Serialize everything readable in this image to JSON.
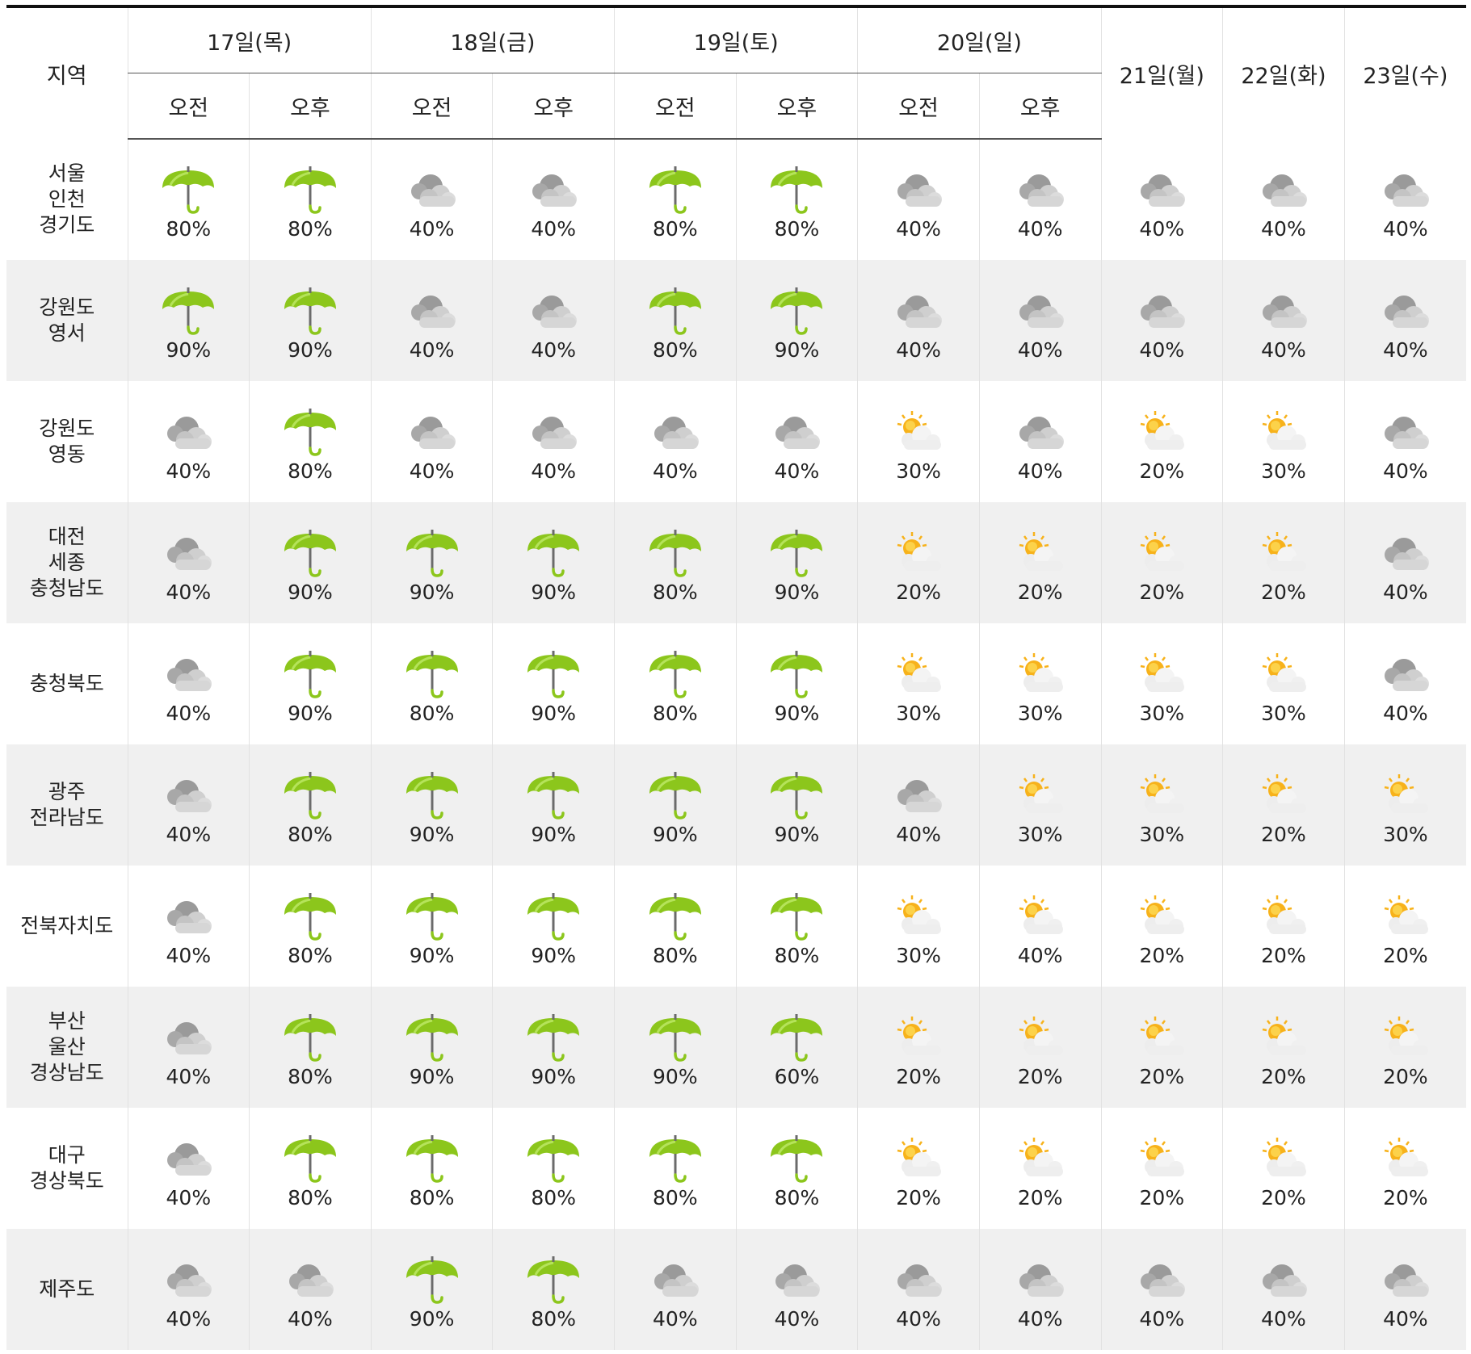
{
  "header": {
    "region_label": "지역",
    "am_label": "오전",
    "pm_label": "오후",
    "split_days": [
      "17일(목)",
      "18일(금)",
      "19일(토)",
      "20일(일)"
    ],
    "single_days": [
      "21일(월)",
      "22일(화)",
      "23일(수)"
    ]
  },
  "icon_legend": {
    "umbrella": "rain-umbrella-icon",
    "cloud": "cloudy-icon",
    "sun": "partly-cloudy-icon"
  },
  "colors": {
    "umbrella_green": "#8cc61c",
    "cloud_gray": "#b8b8b8",
    "sun_yellow": "#f7b21b",
    "alt_row_bg": "#f0f0f0"
  },
  "rows": [
    {
      "region": [
        "서울",
        "인천",
        "경기도"
      ],
      "cells": [
        {
          "icon": "umbrella",
          "pct": "80%"
        },
        {
          "icon": "umbrella",
          "pct": "80%"
        },
        {
          "icon": "cloud",
          "pct": "40%"
        },
        {
          "icon": "cloud",
          "pct": "40%"
        },
        {
          "icon": "umbrella",
          "pct": "80%"
        },
        {
          "icon": "umbrella",
          "pct": "80%"
        },
        {
          "icon": "cloud",
          "pct": "40%"
        },
        {
          "icon": "cloud",
          "pct": "40%"
        },
        {
          "icon": "cloud",
          "pct": "40%"
        },
        {
          "icon": "cloud",
          "pct": "40%"
        },
        {
          "icon": "cloud",
          "pct": "40%"
        }
      ]
    },
    {
      "region": [
        "강원도",
        "영서"
      ],
      "cells": [
        {
          "icon": "umbrella",
          "pct": "90%"
        },
        {
          "icon": "umbrella",
          "pct": "90%"
        },
        {
          "icon": "cloud",
          "pct": "40%"
        },
        {
          "icon": "cloud",
          "pct": "40%"
        },
        {
          "icon": "umbrella",
          "pct": "80%"
        },
        {
          "icon": "umbrella",
          "pct": "90%"
        },
        {
          "icon": "cloud",
          "pct": "40%"
        },
        {
          "icon": "cloud",
          "pct": "40%"
        },
        {
          "icon": "cloud",
          "pct": "40%"
        },
        {
          "icon": "cloud",
          "pct": "40%"
        },
        {
          "icon": "cloud",
          "pct": "40%"
        }
      ]
    },
    {
      "region": [
        "강원도",
        "영동"
      ],
      "cells": [
        {
          "icon": "cloud",
          "pct": "40%"
        },
        {
          "icon": "umbrella",
          "pct": "80%"
        },
        {
          "icon": "cloud",
          "pct": "40%"
        },
        {
          "icon": "cloud",
          "pct": "40%"
        },
        {
          "icon": "cloud",
          "pct": "40%"
        },
        {
          "icon": "cloud",
          "pct": "40%"
        },
        {
          "icon": "sun",
          "pct": "30%"
        },
        {
          "icon": "cloud",
          "pct": "40%"
        },
        {
          "icon": "sun",
          "pct": "20%"
        },
        {
          "icon": "sun",
          "pct": "30%"
        },
        {
          "icon": "cloud",
          "pct": "40%"
        }
      ]
    },
    {
      "region": [
        "대전",
        "세종",
        "충청남도"
      ],
      "cells": [
        {
          "icon": "cloud",
          "pct": "40%"
        },
        {
          "icon": "umbrella",
          "pct": "90%"
        },
        {
          "icon": "umbrella",
          "pct": "90%"
        },
        {
          "icon": "umbrella",
          "pct": "90%"
        },
        {
          "icon": "umbrella",
          "pct": "80%"
        },
        {
          "icon": "umbrella",
          "pct": "90%"
        },
        {
          "icon": "sun",
          "pct": "20%"
        },
        {
          "icon": "sun",
          "pct": "20%"
        },
        {
          "icon": "sun",
          "pct": "20%"
        },
        {
          "icon": "sun",
          "pct": "20%"
        },
        {
          "icon": "cloud",
          "pct": "40%"
        }
      ]
    },
    {
      "region": [
        "충청북도"
      ],
      "cells": [
        {
          "icon": "cloud",
          "pct": "40%"
        },
        {
          "icon": "umbrella",
          "pct": "90%"
        },
        {
          "icon": "umbrella",
          "pct": "80%"
        },
        {
          "icon": "umbrella",
          "pct": "90%"
        },
        {
          "icon": "umbrella",
          "pct": "80%"
        },
        {
          "icon": "umbrella",
          "pct": "90%"
        },
        {
          "icon": "sun",
          "pct": "30%"
        },
        {
          "icon": "sun",
          "pct": "30%"
        },
        {
          "icon": "sun",
          "pct": "30%"
        },
        {
          "icon": "sun",
          "pct": "30%"
        },
        {
          "icon": "cloud",
          "pct": "40%"
        }
      ]
    },
    {
      "region": [
        "광주",
        "전라남도"
      ],
      "cells": [
        {
          "icon": "cloud",
          "pct": "40%"
        },
        {
          "icon": "umbrella",
          "pct": "80%"
        },
        {
          "icon": "umbrella",
          "pct": "90%"
        },
        {
          "icon": "umbrella",
          "pct": "90%"
        },
        {
          "icon": "umbrella",
          "pct": "90%"
        },
        {
          "icon": "umbrella",
          "pct": "90%"
        },
        {
          "icon": "cloud",
          "pct": "40%"
        },
        {
          "icon": "sun",
          "pct": "30%"
        },
        {
          "icon": "sun",
          "pct": "30%"
        },
        {
          "icon": "sun",
          "pct": "20%"
        },
        {
          "icon": "sun",
          "pct": "30%"
        }
      ]
    },
    {
      "region": [
        "전북자치도"
      ],
      "cells": [
        {
          "icon": "cloud",
          "pct": "40%"
        },
        {
          "icon": "umbrella",
          "pct": "80%"
        },
        {
          "icon": "umbrella",
          "pct": "90%"
        },
        {
          "icon": "umbrella",
          "pct": "90%"
        },
        {
          "icon": "umbrella",
          "pct": "80%"
        },
        {
          "icon": "umbrella",
          "pct": "80%"
        },
        {
          "icon": "sun",
          "pct": "30%"
        },
        {
          "icon": "sun",
          "pct": "40%"
        },
        {
          "icon": "sun",
          "pct": "20%"
        },
        {
          "icon": "sun",
          "pct": "20%"
        },
        {
          "icon": "sun",
          "pct": "20%"
        }
      ]
    },
    {
      "region": [
        "부산",
        "울산",
        "경상남도"
      ],
      "cells": [
        {
          "icon": "cloud",
          "pct": "40%"
        },
        {
          "icon": "umbrella",
          "pct": "80%"
        },
        {
          "icon": "umbrella",
          "pct": "90%"
        },
        {
          "icon": "umbrella",
          "pct": "90%"
        },
        {
          "icon": "umbrella",
          "pct": "90%"
        },
        {
          "icon": "umbrella",
          "pct": "60%"
        },
        {
          "icon": "sun",
          "pct": "20%"
        },
        {
          "icon": "sun",
          "pct": "20%"
        },
        {
          "icon": "sun",
          "pct": "20%"
        },
        {
          "icon": "sun",
          "pct": "20%"
        },
        {
          "icon": "sun",
          "pct": "20%"
        }
      ]
    },
    {
      "region": [
        "대구",
        "경상북도"
      ],
      "cells": [
        {
          "icon": "cloud",
          "pct": "40%"
        },
        {
          "icon": "umbrella",
          "pct": "80%"
        },
        {
          "icon": "umbrella",
          "pct": "80%"
        },
        {
          "icon": "umbrella",
          "pct": "80%"
        },
        {
          "icon": "umbrella",
          "pct": "80%"
        },
        {
          "icon": "umbrella",
          "pct": "80%"
        },
        {
          "icon": "sun",
          "pct": "20%"
        },
        {
          "icon": "sun",
          "pct": "20%"
        },
        {
          "icon": "sun",
          "pct": "20%"
        },
        {
          "icon": "sun",
          "pct": "20%"
        },
        {
          "icon": "sun",
          "pct": "20%"
        }
      ]
    },
    {
      "region": [
        "제주도"
      ],
      "cells": [
        {
          "icon": "cloud",
          "pct": "40%"
        },
        {
          "icon": "cloud",
          "pct": "40%"
        },
        {
          "icon": "umbrella",
          "pct": "90%"
        },
        {
          "icon": "umbrella",
          "pct": "80%"
        },
        {
          "icon": "cloud",
          "pct": "40%"
        },
        {
          "icon": "cloud",
          "pct": "40%"
        },
        {
          "icon": "cloud",
          "pct": "40%"
        },
        {
          "icon": "cloud",
          "pct": "40%"
        },
        {
          "icon": "cloud",
          "pct": "40%"
        },
        {
          "icon": "cloud",
          "pct": "40%"
        },
        {
          "icon": "cloud",
          "pct": "40%"
        }
      ]
    }
  ]
}
